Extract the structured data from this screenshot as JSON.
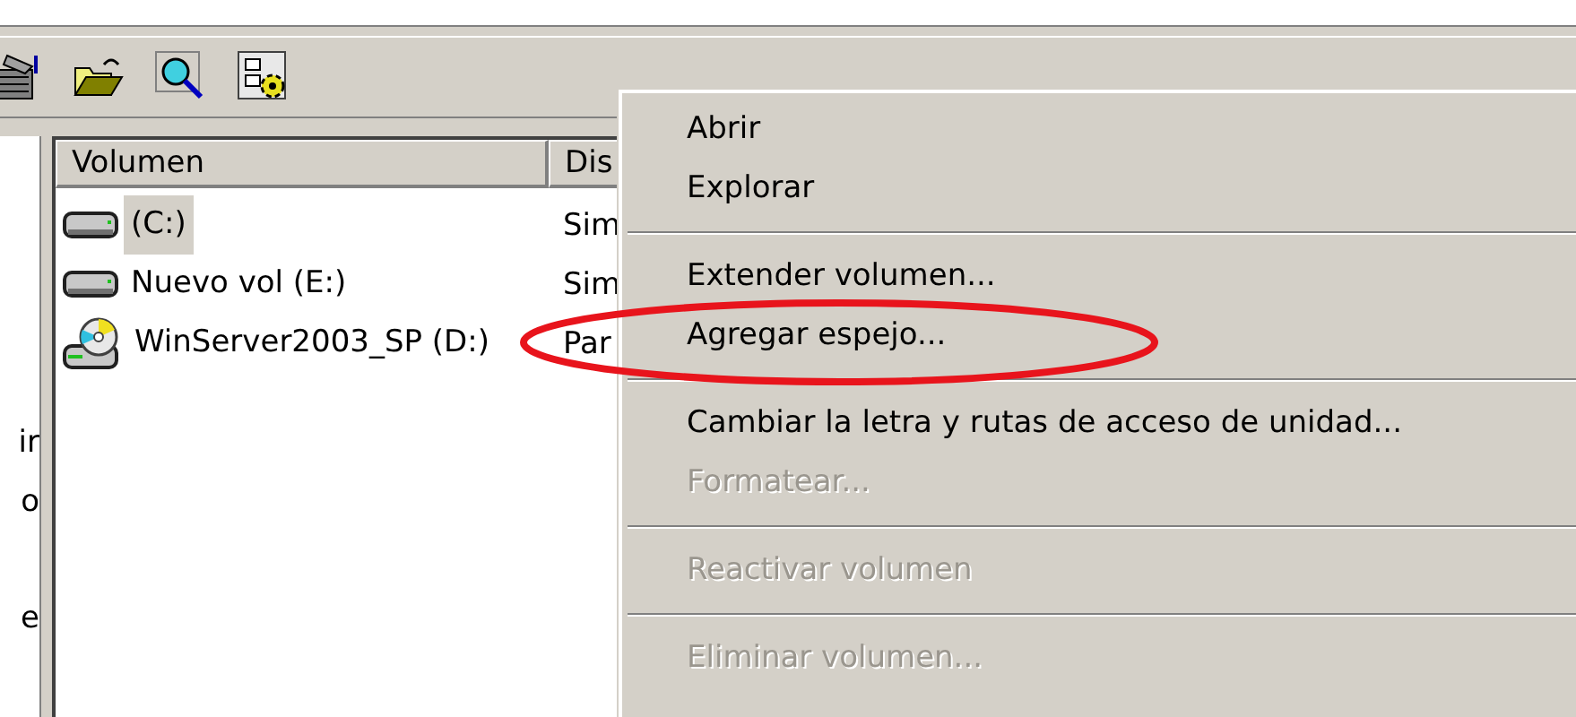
{
  "tree": {
    "items": [
      {
        "label": "ir"
      },
      {
        "label": "o"
      },
      {
        "label": "e"
      }
    ]
  },
  "volume_list": {
    "columns": [
      "Volumen",
      "Dis"
    ],
    "rows": [
      {
        "kind": "disk",
        "name": "(C:)",
        "column_2": "Sim",
        "selected": true
      },
      {
        "kind": "disk",
        "name": "Nuevo vol (E:)",
        "column_2": "Sim",
        "selected": false
      },
      {
        "kind": "cd",
        "name": "WinServer2003_SP (D:)",
        "column_2": "Par",
        "selected": false
      }
    ]
  },
  "context_menu": {
    "items": [
      {
        "kind": "item",
        "label": "Abrir",
        "disabled": false
      },
      {
        "kind": "item",
        "label": "Explorar",
        "disabled": false
      },
      {
        "kind": "separator"
      },
      {
        "kind": "item",
        "label": "Extender volumen...",
        "disabled": false
      },
      {
        "kind": "item",
        "label": "Agregar espejo...",
        "disabled": false
      },
      {
        "kind": "separator"
      },
      {
        "kind": "item",
        "label": "Cambiar la letra y rutas de acceso de unidad...",
        "disabled": false
      },
      {
        "kind": "item",
        "label": "Formatear...",
        "disabled": true
      },
      {
        "kind": "separator"
      },
      {
        "kind": "item",
        "label": "Reactivar volumen",
        "disabled": true
      },
      {
        "kind": "separator"
      },
      {
        "kind": "item",
        "label": "Eliminar volumen...",
        "disabled": true
      }
    ]
  }
}
